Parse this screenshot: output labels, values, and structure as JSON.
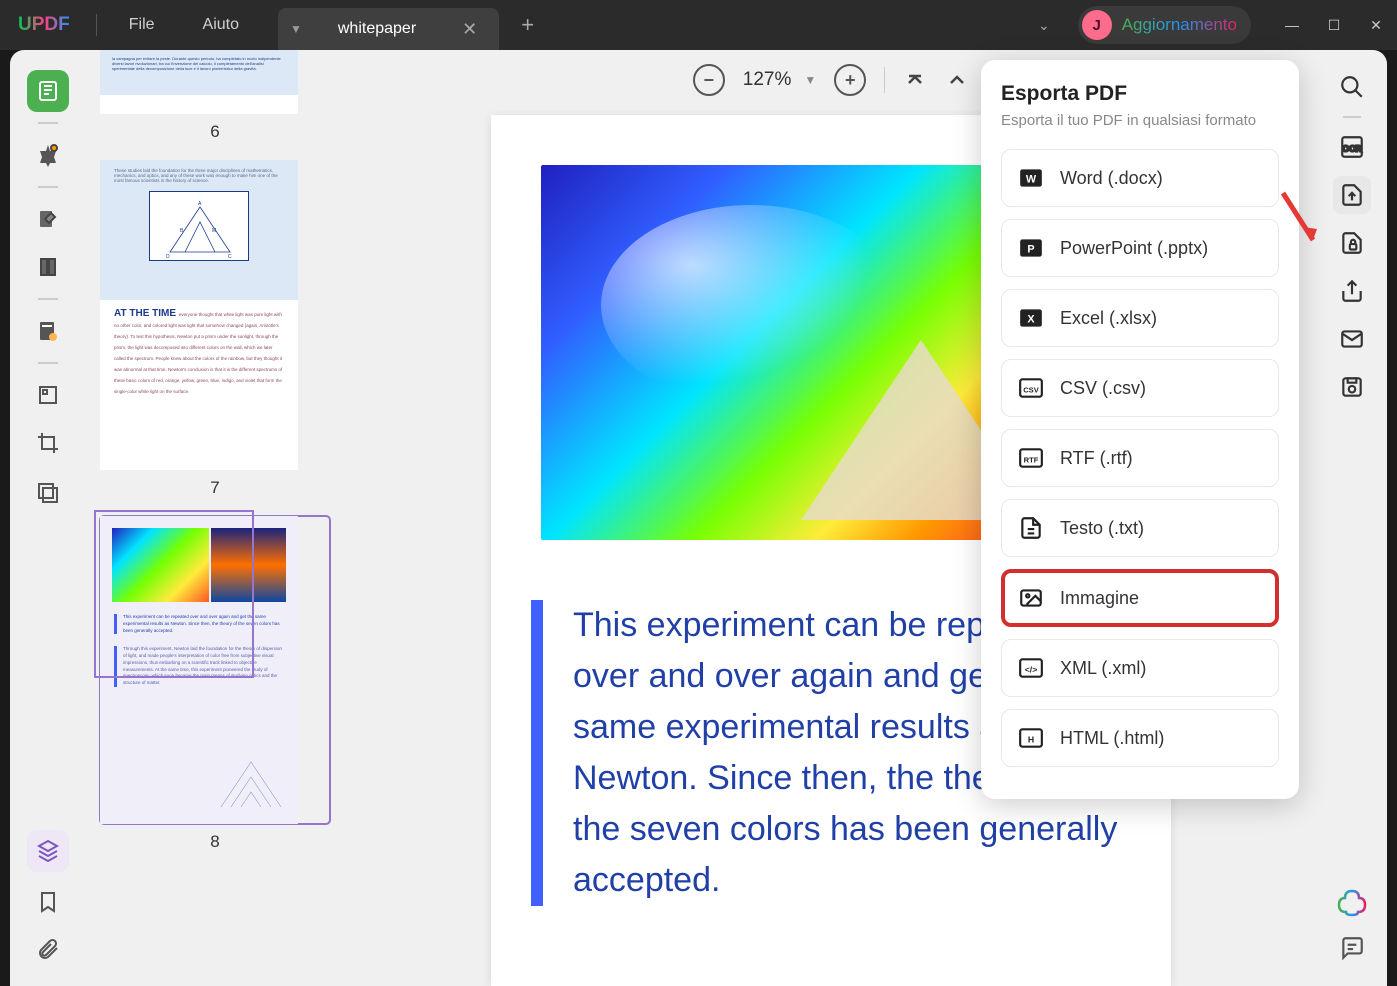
{
  "title_bar": {
    "logo": "UPDF",
    "menus": {
      "file": "File",
      "help": "Aiuto"
    },
    "tab": {
      "title": "whitepaper"
    },
    "user": {
      "initial": "J",
      "update_label": "Aggiornamento"
    }
  },
  "top_toolbar": {
    "zoom": "127%"
  },
  "thumbnails": [
    {
      "num": "6"
    },
    {
      "num": "7",
      "heading": "AT THE TIME"
    },
    {
      "num": "8"
    }
  ],
  "document": {
    "quote": "This experiment can be repeated over and over again and get the same experimental results as Newton. Since then, the theory of the seven colors has been generally accepted."
  },
  "export_panel": {
    "title": "Esporta PDF",
    "subtitle": "Esporta il tuo PDF in qualsiasi formato",
    "options": {
      "word": "Word (.docx)",
      "powerpoint": "PowerPoint (.pptx)",
      "excel": "Excel (.xlsx)",
      "csv": "CSV (.csv)",
      "rtf": "RTF (.rtf)",
      "text": "Testo (.txt)",
      "image": "Immagine",
      "xml": "XML (.xml)",
      "html": "HTML (.html)"
    }
  },
  "thumb_texts": {
    "t6": "la campagna per evitare la peste. Durante questo periodo, ha completato in modo indipendente diversi lavori rivoluzionari, tra cui l'invenzione del calcolo, il completamento dell'analisi sperimentale della decomposizione della luce e il lavoro pionieristico della gravità.",
    "t7_intro": "These studies laid the foundation for the three major disciplines of mathematics, mechanics, and optics, and any of these work was enough to make him one of the most famous scientists in the history of science.",
    "t7_body": "everyone thought that white light was pure light with no other color, and colored light was light that somehow changed (again, Aristotle's theory). To test this hypothesis, Newton put a prism under the sunlight, through the prism, the light was decomposed into different colors on the wall, which we later called the spectrum. People knew about the colors of the rainbow, but they thought it was abnormal at that time. Newton's conclusion is that it is the different spectrums of these basic colors of red, orange, yellow, green, blue, indigo, and violet that form the single-color white light on the surface.",
    "t8_q": "This experiment can be repeated over and over again and get the same experimental results as Newton. Since then, the theory of the seven colors has been generally accepted.",
    "t8_body": "Through this experiment, Newton laid the foundation for the theory of dispersion of light, and made people's interpretation of color free from subjective visual impressions, thus embarking on a scientific track linked to objective measurements. At the same time, this experiment pioneered the study of spectroscopy, which soon became the main means of studying optics and the structure of matter."
  }
}
